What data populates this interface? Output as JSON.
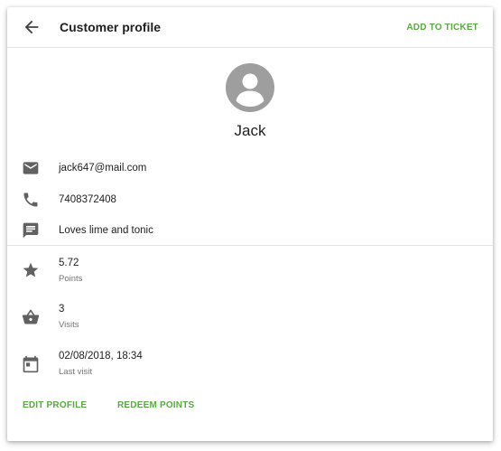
{
  "header": {
    "title": "Customer profile",
    "add_to_ticket_label": "ADD TO TICKET"
  },
  "customer": {
    "name": "Jack",
    "email": "jack647@mail.com",
    "phone": "7408372408",
    "note": "Loves lime and tonic"
  },
  "stats": {
    "points_value": "5.72",
    "points_label": "Points",
    "visits_value": "3",
    "visits_label": "Visits",
    "last_visit_value": "02/08/2018, 18:34",
    "last_visit_label": "Last visit"
  },
  "actions": {
    "edit_profile_label": "EDIT PROFILE",
    "redeem_points_label": "REDEEM POINTS"
  },
  "icons": {
    "back": "arrow-back-icon",
    "avatar": "account-circle-icon",
    "email": "email-icon",
    "phone": "phone-icon",
    "note": "comment-icon",
    "points": "star-icon",
    "visits": "basket-icon",
    "last_visit": "calendar-icon"
  },
  "colors": {
    "accent": "#59a943",
    "icon": "#616161",
    "avatar": "#9e9e9e"
  }
}
